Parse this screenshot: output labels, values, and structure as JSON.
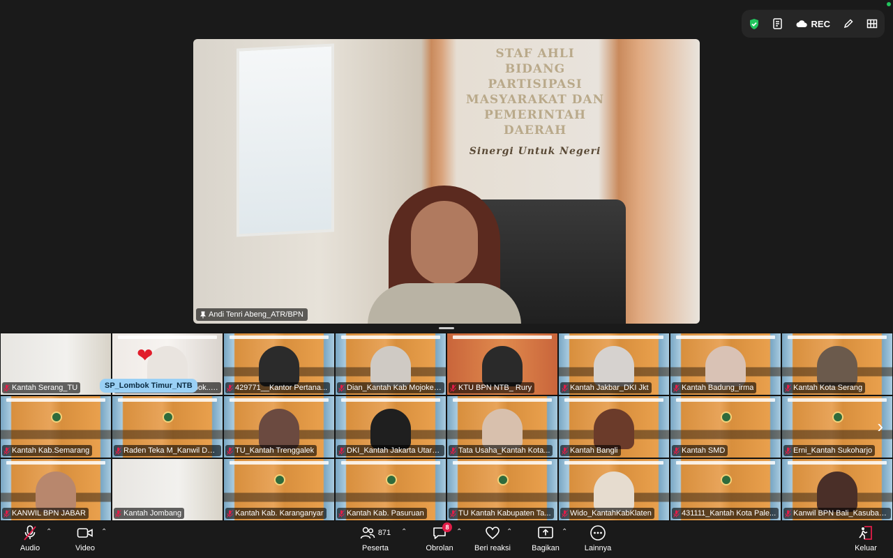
{
  "top_bar": {
    "rec_label": "REC",
    "icons": [
      "shield-icon",
      "notes-icon",
      "cloud-icon",
      "pen-icon",
      "grid-icon"
    ]
  },
  "speaker": {
    "name": "Andi Tenri Abeng_ATR/BPN",
    "sign_line1": "STAF AHLI",
    "sign_line2": "BIDANG PARTISIPASI",
    "sign_line3": "MASYARAKAT DAN",
    "sign_line4": "PEMERINTAH DAERAH",
    "sign_tagline": "Sinergi Untuk Negeri"
  },
  "hover_name": "SP_Lombok Timur_NTB",
  "participants": [
    {
      "name": "Kantah Serang_TU"
    },
    {
      "name": "Raden_Kantah_Lombok...PN"
    },
    {
      "name": "429771__Kantor Pertana..."
    },
    {
      "name": "Dian_Kantah Kab Mojoker..."
    },
    {
      "name": "KTU BPN NTB_ Rury"
    },
    {
      "name": "Kantah Jakbar_DKI Jkt"
    },
    {
      "name": "Kantah Badung_irma"
    },
    {
      "name": "Kantah Kota Serang"
    },
    {
      "name": "Kantah Kab.Semarang"
    },
    {
      "name": "Raden Teka M_Kanwil DKI..."
    },
    {
      "name": "TU_Kantah Trenggalek"
    },
    {
      "name": "DKI_Kantah Jakarta Utara..."
    },
    {
      "name": "Tata Usaha_Kantah Kota..."
    },
    {
      "name": "Kantah Bangli"
    },
    {
      "name": "Kantah SMD"
    },
    {
      "name": "Erni_Kantah Sukoharjo"
    },
    {
      "name": "KANWIL BPN JABAR"
    },
    {
      "name": "Kantah Jombang"
    },
    {
      "name": "Kantah Kab. Karanganyar"
    },
    {
      "name": "Kantah Kab. Pasuruan"
    },
    {
      "name": "TU Kantah Kabupaten Ta..."
    },
    {
      "name": "Wido_KantahKabKlaten"
    },
    {
      "name": "431111_Kantah Kota Pale..."
    },
    {
      "name": "Kanwil BPN Bali_Kasubag..."
    }
  ],
  "toolbar": {
    "audio": "Audio",
    "video": "Video",
    "participants": "Peserta",
    "participants_count": "871",
    "chat": "Obrolan",
    "chat_badge": "8",
    "reactions": "Beri reaksi",
    "share": "Bagikan",
    "more": "Lainnya",
    "leave": "Keluar"
  },
  "colors": {
    "background": "#1a1a1a",
    "shield": "#22c55e",
    "badge": "#e11d48",
    "leave": "#e11d48"
  }
}
